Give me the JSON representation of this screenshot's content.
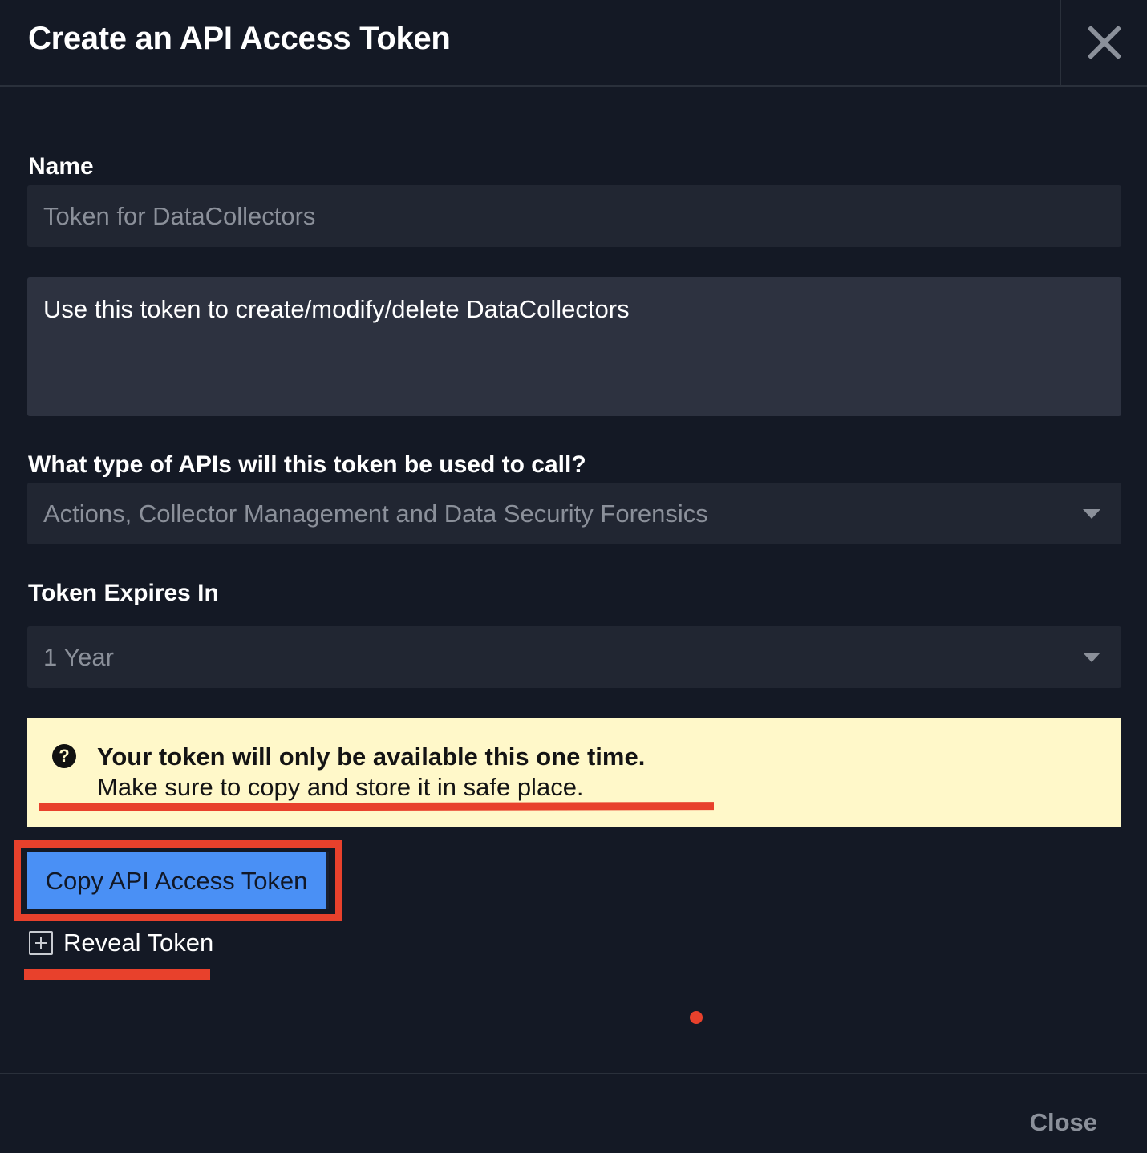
{
  "header": {
    "title": "Create an API Access Token",
    "close_icon": "close-icon"
  },
  "form": {
    "name_label": "Name",
    "name_placeholder": "Token for DataCollectors",
    "description_value": "Use this token to create/modify/delete DataCollectors",
    "api_type_label": "What type of APIs will this token be used to call?",
    "api_type_value": "Actions, Collector Management and Data Security Forensics",
    "expires_label": "Token Expires In",
    "expires_value": "1 Year"
  },
  "notice": {
    "icon": "question-circle-icon",
    "bold_text": "Your token will only be available this one time.",
    "text": "Make sure to copy and store it in safe place."
  },
  "actions": {
    "copy_label": "Copy API Access Token",
    "reveal_label": "Reveal Token",
    "reveal_icon": "plus-square-icon"
  },
  "footer": {
    "close_label": "Close"
  },
  "colors": {
    "background": "#141925",
    "field": "#212632",
    "notice_bg": "#fff8c9",
    "accent": "#4a90f5",
    "annotation": "#e8412c"
  }
}
